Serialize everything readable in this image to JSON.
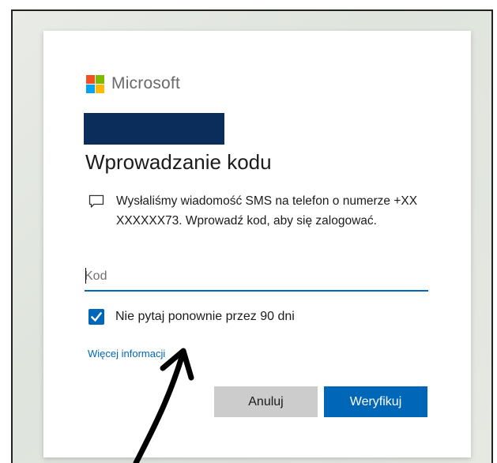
{
  "brand": {
    "name": "Microsoft",
    "logo_colors": [
      "#f25022",
      "#7fba00",
      "#00a4ef",
      "#ffb900"
    ]
  },
  "page_title": "Wprowadzanie kodu",
  "message": {
    "icon": "message-bubble-icon",
    "text": "Wysłaliśmy wiadomość SMS na telefon o numerze +XX XXXXXX73. Wprowadź kod, aby się zalogować."
  },
  "code_field": {
    "placeholder": "Kod",
    "value": ""
  },
  "remember": {
    "label": "Nie pytaj ponownie przez 90 dni",
    "checked": true
  },
  "more_info_link": "Więcej informacji",
  "buttons": {
    "cancel": "Anuluj",
    "verify": "Weryfikuj"
  },
  "colors": {
    "accent": "#0067b8",
    "redaction": "#0b2d5c",
    "secondary_button": "#cccccc"
  },
  "annotation": {
    "icon": "hand-drawn-arrow-icon"
  }
}
